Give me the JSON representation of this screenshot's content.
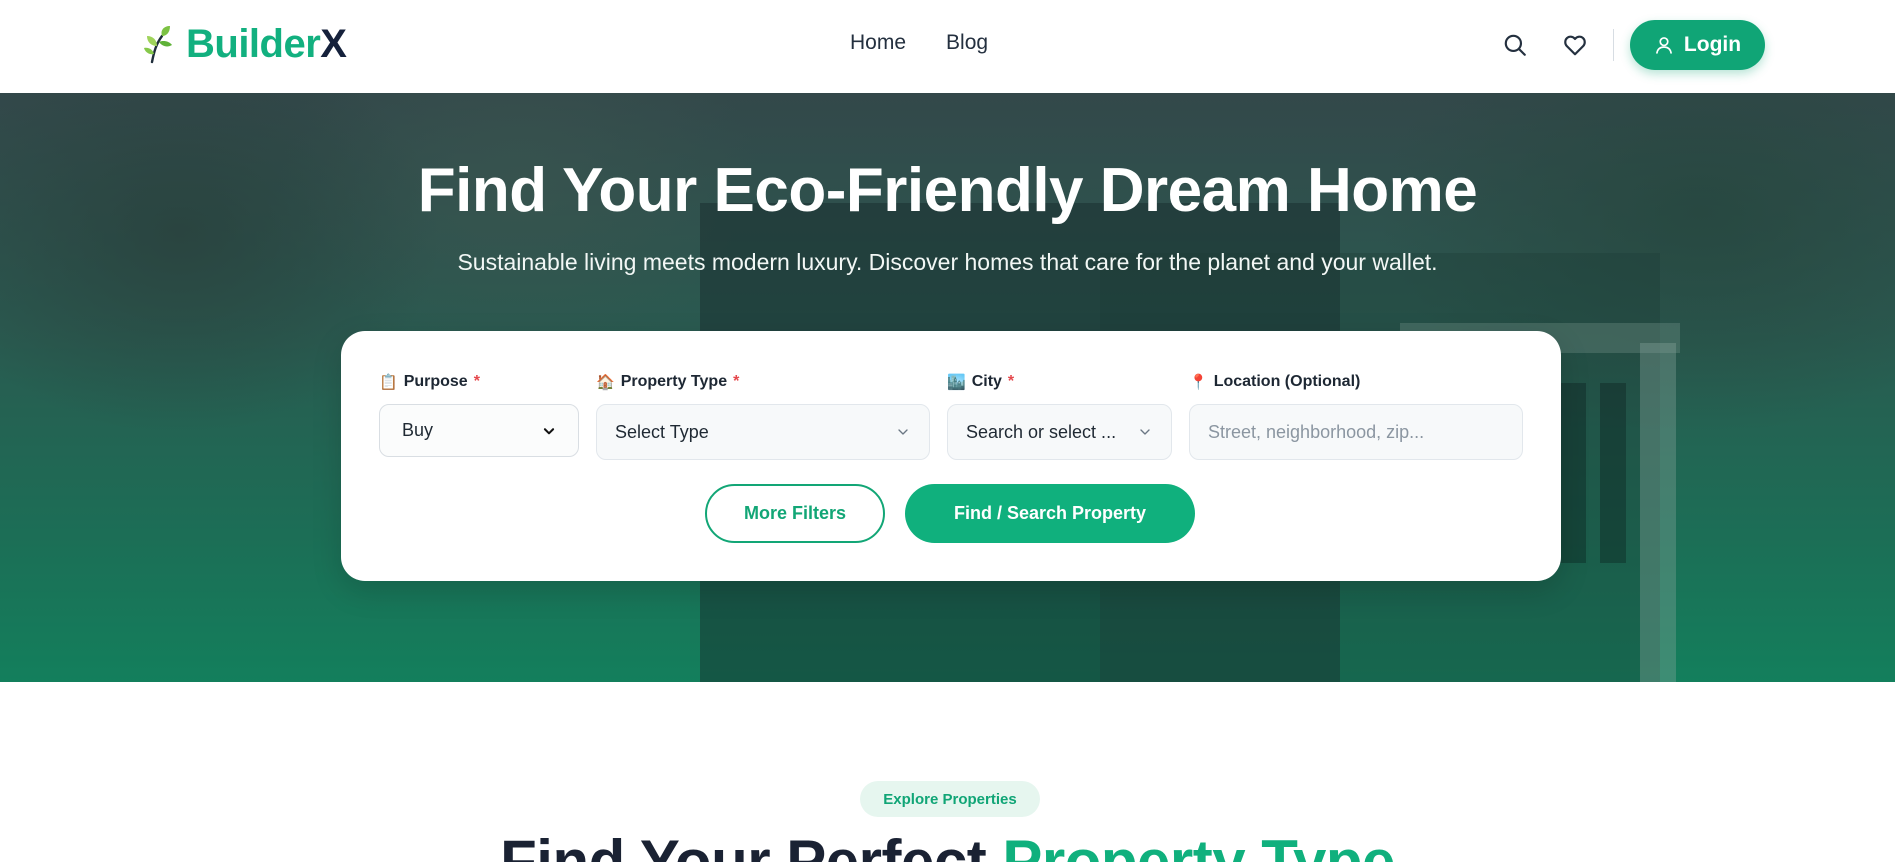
{
  "header": {
    "logo": {
      "part1": "Builder",
      "part2": "X"
    },
    "nav": [
      {
        "label": "Home"
      },
      {
        "label": "Blog"
      }
    ],
    "login_label": "Login"
  },
  "hero": {
    "title": "Find Your Eco-Friendly Dream Home",
    "subtitle": "Sustainable living meets modern luxury. Discover homes that care for the planet and your wallet."
  },
  "search": {
    "fields": {
      "purpose": {
        "emoji": "📋",
        "label": "Purpose",
        "required": "*",
        "value": "Buy"
      },
      "property_type": {
        "emoji": "🏠",
        "label": "Property Type",
        "required": "*",
        "value": "Select Type"
      },
      "city": {
        "emoji": "🏙️",
        "label": "City",
        "required": "*",
        "value": "Search or select ..."
      },
      "location": {
        "emoji": "📍",
        "label": "Location (Optional)",
        "placeholder": "Street, neighborhood, zip..."
      }
    },
    "more_filters_label": "More Filters",
    "submit_label": "Find / Search Property"
  },
  "section": {
    "badge": "Explore Properties",
    "title_part1": "Find Your Perfect ",
    "title_part2": "Property Type"
  },
  "icons": {
    "logo": "leaf-sprout-icon",
    "search": "search-icon",
    "favorites": "heart-icon",
    "login": "user-icon",
    "select": "chevron-down-icon"
  },
  "colors": {
    "brand_green": "#10b07d",
    "brand_dark": "#15213b",
    "required": "#e5484d"
  }
}
